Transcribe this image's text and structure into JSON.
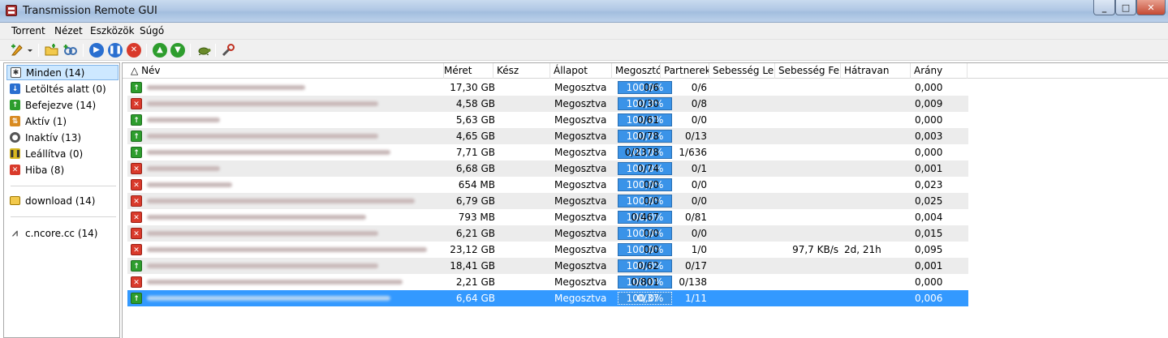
{
  "window": {
    "title": "Transmission Remote GUI",
    "minimize": "_",
    "maximize": "□",
    "close": "✕"
  },
  "menu": [
    "Torrent",
    "Nézet",
    "Eszközök",
    "Súgó"
  ],
  "toolbar": {
    "icons": [
      "add-torrent-icon",
      "dropdown-arrow-icon",
      "open-folder-icon",
      "add-url-icon",
      "start-icon",
      "pause-icon",
      "remove-icon",
      "move-up-icon",
      "move-down-icon",
      "turtle-mode-icon",
      "settings-icon"
    ]
  },
  "colors": {
    "selection": "#3399ff",
    "progress": "#3a93e8",
    "ok": "#2d9d2d",
    "error": "#d93a2b"
  },
  "sidebar": {
    "states": [
      {
        "label": "Minden (14)",
        "icon": "all-icon",
        "selected": true
      },
      {
        "label": "Letöltés alatt (0)",
        "icon": "downloading-icon"
      },
      {
        "label": "Befejezve (14)",
        "icon": "completed-icon"
      },
      {
        "label": "Aktív (1)",
        "icon": "active-icon"
      },
      {
        "label": "Inaktív (13)",
        "icon": "inactive-icon"
      },
      {
        "label": "Leállítva (0)",
        "icon": "stopped-icon"
      },
      {
        "label": "Hiba (8)",
        "icon": "error-icon"
      }
    ],
    "folders": [
      {
        "label": "download (14)",
        "icon": "folder-icon"
      }
    ],
    "trackers": [
      {
        "label": "c.ncore.cc (14)",
        "icon": "tracker-icon"
      }
    ]
  },
  "columns": [
    "Név",
    "Méret",
    "Kész",
    "Állapot",
    "Megosztó",
    "Partnerek",
    "Sebesség Le",
    "Sebesség Fel",
    "Hátravan",
    "Arány"
  ],
  "sort_indicator": "△",
  "torrents": [
    {
      "status": "ok",
      "size": "17,30 GB",
      "done": "100,0%",
      "state": "Megosztva",
      "seeds": "0/6",
      "peers": "0/6",
      "down": "",
      "up": "",
      "eta": "",
      "ratio": "0,000"
    },
    {
      "status": "err",
      "size": "4,58 GB",
      "done": "100,0%",
      "state": "Megosztva",
      "seeds": "0/30",
      "peers": "0/8",
      "down": "",
      "up": "",
      "eta": "",
      "ratio": "0,009"
    },
    {
      "status": "ok",
      "size": "5,63 GB",
      "done": "100,0%",
      "state": "Megosztva",
      "seeds": "0/61",
      "peers": "0/0",
      "down": "",
      "up": "",
      "eta": "",
      "ratio": "0,000"
    },
    {
      "status": "ok",
      "size": "4,65 GB",
      "done": "100,0%",
      "state": "Megosztva",
      "seeds": "0/78",
      "peers": "0/13",
      "down": "",
      "up": "",
      "eta": "",
      "ratio": "0,003"
    },
    {
      "status": "ok",
      "size": "7,71 GB",
      "done": "100,0%",
      "state": "Megosztva",
      "seeds": "0/2378",
      "peers": "1/636",
      "down": "",
      "up": "",
      "eta": "",
      "ratio": "0,000"
    },
    {
      "status": "err",
      "size": "6,68 GB",
      "done": "100,0%",
      "state": "Megosztva",
      "seeds": "0/74",
      "peers": "0/1",
      "down": "",
      "up": "",
      "eta": "",
      "ratio": "0,001"
    },
    {
      "status": "err",
      "size": "654 MB",
      "done": "100,0%",
      "state": "Megosztva",
      "seeds": "0/0",
      "peers": "0/0",
      "down": "",
      "up": "",
      "eta": "",
      "ratio": "0,023"
    },
    {
      "status": "err",
      "size": "6,79 GB",
      "done": "100,0%",
      "state": "Megosztva",
      "seeds": "0/0",
      "peers": "0/0",
      "down": "",
      "up": "",
      "eta": "",
      "ratio": "0,025"
    },
    {
      "status": "err",
      "size": "793 MB",
      "done": "100,0%",
      "state": "Megosztva",
      "seeds": "0/467",
      "peers": "0/81",
      "down": "",
      "up": "",
      "eta": "",
      "ratio": "0,004"
    },
    {
      "status": "err",
      "size": "6,21 GB",
      "done": "100,0%",
      "state": "Megosztva",
      "seeds": "0/0",
      "peers": "0/0",
      "down": "",
      "up": "",
      "eta": "",
      "ratio": "0,015"
    },
    {
      "status": "err",
      "size": "23,12 GB",
      "done": "100,0%",
      "state": "Megosztva",
      "seeds": "0/0",
      "peers": "1/0",
      "down": "",
      "up": "97,7 KB/s",
      "eta": "2d, 21h",
      "ratio": "0,095"
    },
    {
      "status": "ok",
      "size": "18,41 GB",
      "done": "100,0%",
      "state": "Megosztva",
      "seeds": "0/62",
      "peers": "0/17",
      "down": "",
      "up": "",
      "eta": "",
      "ratio": "0,001"
    },
    {
      "status": "err",
      "size": "2,21 GB",
      "done": "100,0%",
      "state": "Megosztva",
      "seeds": "0/801",
      "peers": "0/138",
      "down": "",
      "up": "",
      "eta": "",
      "ratio": "0,000"
    },
    {
      "status": "ok",
      "size": "6,64 GB",
      "done": "100,0%",
      "state": "Megosztva",
      "seeds": "0/37",
      "peers": "1/11",
      "down": "",
      "up": "",
      "eta": "",
      "ratio": "0,006",
      "selected": true
    }
  ]
}
